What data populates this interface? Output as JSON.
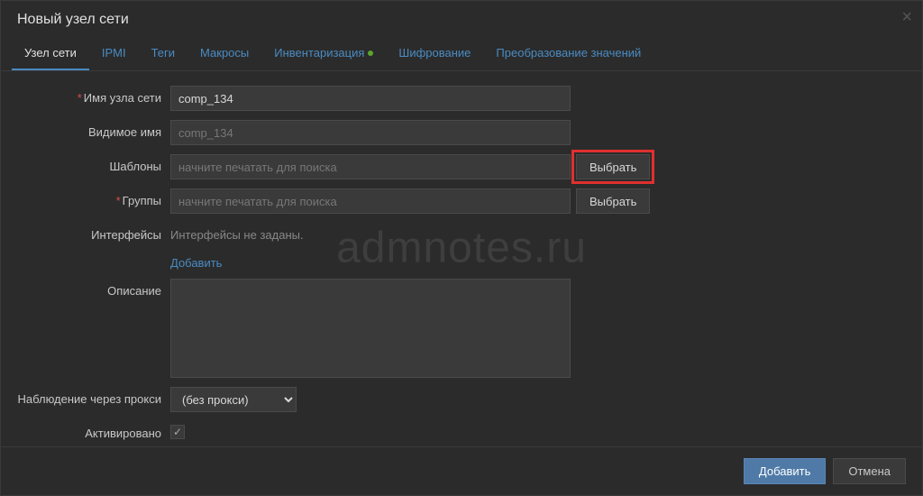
{
  "dialog": {
    "title": "Новый узел сети"
  },
  "tabs": [
    {
      "label": "Узел сети",
      "active": true,
      "indicator": false
    },
    {
      "label": "IPMI",
      "active": false,
      "indicator": false
    },
    {
      "label": "Теги",
      "active": false,
      "indicator": false
    },
    {
      "label": "Макросы",
      "active": false,
      "indicator": false
    },
    {
      "label": "Инвентаризация",
      "active": false,
      "indicator": true
    },
    {
      "label": "Шифрование",
      "active": false,
      "indicator": false
    },
    {
      "label": "Преобразование значений",
      "active": false,
      "indicator": false
    }
  ],
  "form": {
    "host_name": {
      "label": "Имя узла сети",
      "value": "comp_134",
      "required": true
    },
    "visible_name": {
      "label": "Видимое имя",
      "placeholder": "comp_134",
      "value": ""
    },
    "templates": {
      "label": "Шаблоны",
      "placeholder": "начните печатать для поиска",
      "value": "",
      "select_btn": "Выбрать"
    },
    "groups": {
      "label": "Группы",
      "placeholder": "начните печатать для поиска",
      "value": "",
      "required": true,
      "select_btn": "Выбрать"
    },
    "interfaces": {
      "label": "Интерфейсы",
      "empty_text": "Интерфейсы не заданы.",
      "add_link": "Добавить"
    },
    "description": {
      "label": "Описание",
      "value": ""
    },
    "proxy": {
      "label": "Наблюдение через прокси",
      "value": "(без прокси)"
    },
    "activated": {
      "label": "Активировано",
      "checked": true
    }
  },
  "footer": {
    "submit": "Добавить",
    "cancel": "Отмена"
  },
  "watermark": "admnotes.ru"
}
